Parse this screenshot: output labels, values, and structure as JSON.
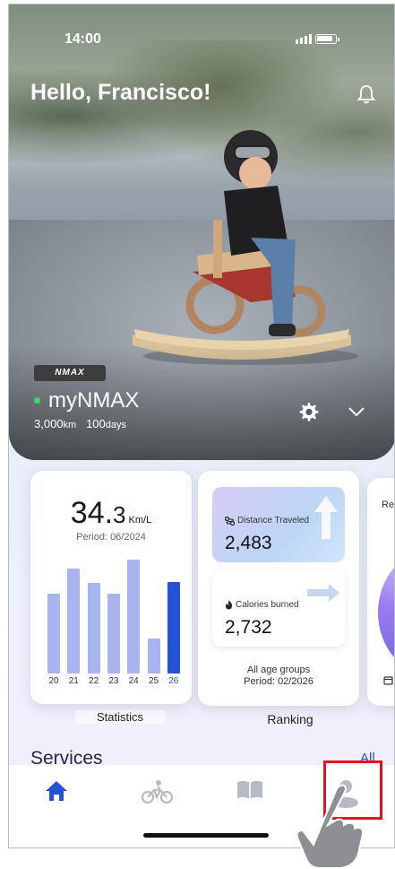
{
  "status_bar": {
    "time": "14:00"
  },
  "header": {
    "greeting": "Hello, Francisco!"
  },
  "vehicle": {
    "brand_badge": "NMAX",
    "name": "myNMAX",
    "distance": "3,000",
    "distance_unit": "km",
    "days": "100",
    "days_unit": "days"
  },
  "statistics_card": {
    "value": "34.",
    "value_decimal": "3",
    "unit": "Km/L",
    "period": "Period: 06/2024",
    "chart_data": {
      "type": "bar",
      "categories": [
        "20",
        "21",
        "22",
        "23",
        "24",
        "25",
        "26"
      ],
      "values": [
        55,
        72,
        62,
        55,
        78,
        24,
        63
      ],
      "highlighted": "26",
      "colors": {
        "default": "#a8b4ef",
        "highlighted": "#2352d6"
      }
    },
    "caption": "Statistics"
  },
  "ranking_card": {
    "distance_label": "Distance Traveled",
    "distance_value": "2,483",
    "calories_label": "Calories burned",
    "calories_value": "2,732",
    "footer_line1": "All age groups",
    "footer_line2": "Period: 02/2026",
    "caption": "Ranking"
  },
  "peek_card": {
    "title": "Re"
  },
  "services": {
    "title": "Services",
    "all_link": "All"
  },
  "bottom_nav": {
    "items": [
      {
        "icon": "home-icon",
        "active": true
      },
      {
        "icon": "bike-icon",
        "active": false
      },
      {
        "icon": "book-icon",
        "active": false
      },
      {
        "icon": "profile-icon",
        "active": false
      }
    ]
  },
  "colors": {
    "accent": "#2352d6",
    "highlight": "#e0141e",
    "online": "#3bd96a"
  }
}
